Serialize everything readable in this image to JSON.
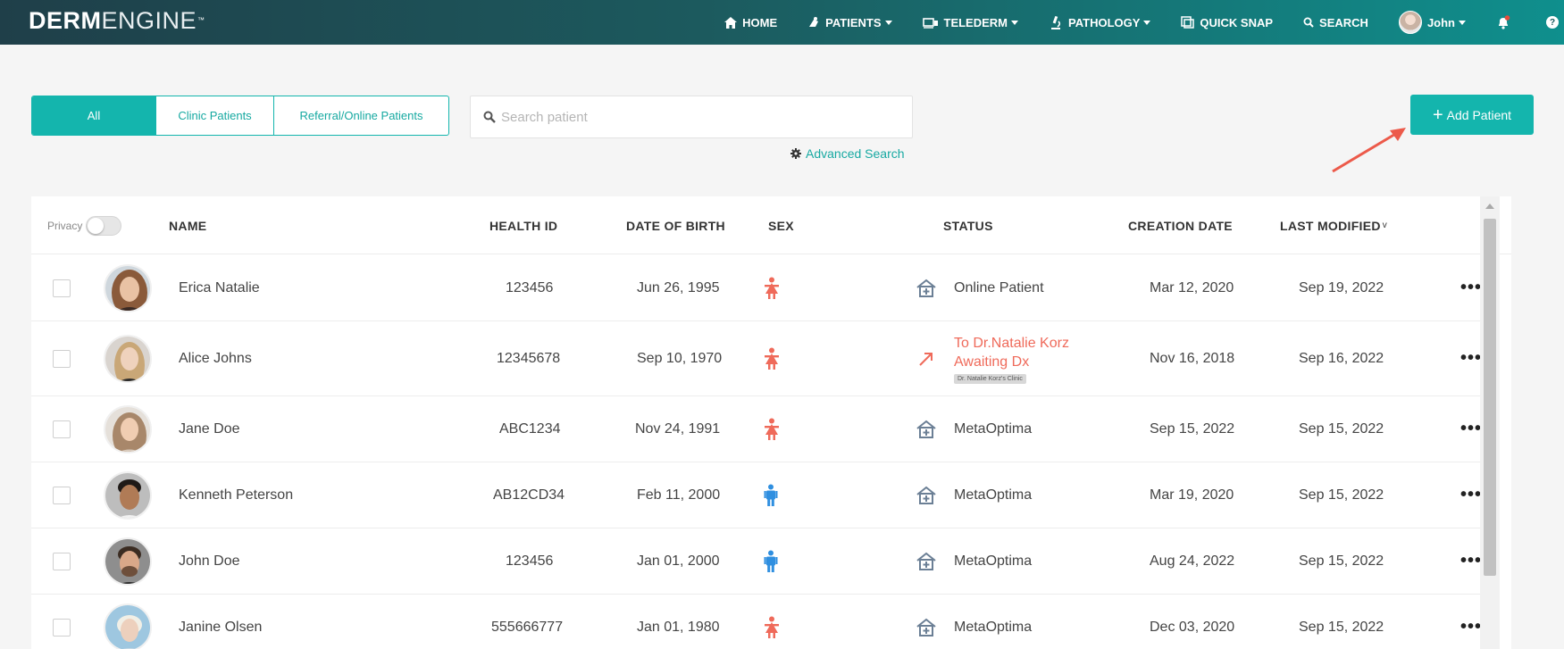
{
  "brand": {
    "bold": "DERM",
    "thin": "ENGINE",
    "tm": "™"
  },
  "nav": {
    "home": "HOME",
    "patients": "PATIENTS",
    "telederm": "TELEDERM",
    "pathology": "PATHOLOGY",
    "quick_snap": "QUICK SNAP",
    "search": "SEARCH",
    "user": "John",
    "help": "?"
  },
  "filters": {
    "tabs": [
      {
        "label": "All",
        "active": true
      },
      {
        "label": "Clinic Patients",
        "active": false
      },
      {
        "label": "Referral/Online Patients",
        "active": false
      }
    ],
    "search_placeholder": "Search patient",
    "advanced_search": "Advanced Search",
    "add_patient": "Add Patient"
  },
  "table": {
    "privacy_label": "Privacy",
    "privacy_on": false,
    "headers": {
      "name": "NAME",
      "health_id": "HEALTH ID",
      "dob": "DATE OF BIRTH",
      "sex": "SEX",
      "status": "STATUS",
      "creation_date": "CREATION DATE",
      "last_modified": "LAST MODIFIED"
    },
    "rows": [
      {
        "name": "Erica Natalie",
        "health_id": "123456",
        "dob": "Jun 26, 1995",
        "sex": "female",
        "status": "Online Patient",
        "status_type": "normal",
        "created": "Mar 12, 2020",
        "modified": "Sep 19, 2022"
      },
      {
        "name": "Alice Johns",
        "health_id": "12345678",
        "dob": "Sep 10, 1970",
        "sex": "female",
        "status_line1": "To Dr.Natalie Korz",
        "status_line2": "Awaiting Dx",
        "clinic_tag": "Dr. Natalie Korz's Clinic",
        "status_type": "referral",
        "created": "Nov 16, 2018",
        "modified": "Sep 16, 2022"
      },
      {
        "name": "Jane Doe",
        "health_id": "ABC1234",
        "dob": "Nov 24, 1991",
        "sex": "female",
        "status": "MetaOptima",
        "status_type": "normal",
        "created": "Sep 15, 2022",
        "modified": "Sep 15, 2022"
      },
      {
        "name": "Kenneth Peterson",
        "health_id": "AB12CD34",
        "dob": "Feb 11, 2000",
        "sex": "male",
        "status": "MetaOptima",
        "status_type": "normal",
        "created": "Mar 19, 2020",
        "modified": "Sep 15, 2022"
      },
      {
        "name": "John Doe",
        "health_id": "123456",
        "dob": "Jan 01, 2000",
        "sex": "male",
        "status": "MetaOptima",
        "status_type": "normal",
        "created": "Aug 24, 2022",
        "modified": "Sep 15, 2022"
      },
      {
        "name": "Janine Olsen",
        "health_id": "555666777",
        "dob": "Jan 01, 1980",
        "sex": "female",
        "status": "MetaOptima",
        "status_type": "normal",
        "created": "Dec 03, 2020",
        "modified": "Sep 15, 2022"
      }
    ]
  },
  "colors": {
    "accent": "#14b5ad",
    "nav_dark": "#1f3f49",
    "female_icon": "#ef6a5a",
    "male_icon": "#2f8fe0",
    "alert_text": "#ef6a5a",
    "annotation_arrow": "#ec5a4a"
  }
}
